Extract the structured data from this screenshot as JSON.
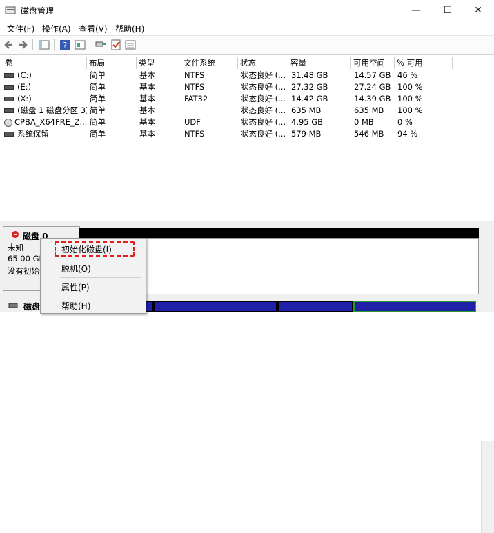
{
  "window": {
    "title": "磁盘管理",
    "minimize": "—",
    "maximize": "☐",
    "close": "✕"
  },
  "menu": [
    "文件(F)",
    "操作(A)",
    "查看(V)",
    "帮助(H)"
  ],
  "columns": [
    "卷",
    "布局",
    "类型",
    "文件系统",
    "状态",
    "容量",
    "可用空间",
    "% 可用"
  ],
  "volumes": [
    {
      "name": "(C:)",
      "layout": "简单",
      "type": "基本",
      "fs": "NTFS",
      "status": "状态良好 (...",
      "capacity": "31.48 GB",
      "free": "14.57 GB",
      "pct": "46 %",
      "icon": "drive-icon"
    },
    {
      "name": "(E:)",
      "layout": "简单",
      "type": "基本",
      "fs": "NTFS",
      "status": "状态良好 (...",
      "capacity": "27.32 GB",
      "free": "27.24 GB",
      "pct": "100 %",
      "icon": "drive-icon"
    },
    {
      "name": "(X:)",
      "layout": "简单",
      "type": "基本",
      "fs": "FAT32",
      "status": "状态良好 (...",
      "capacity": "14.42 GB",
      "free": "14.39 GB",
      "pct": "100 %",
      "icon": "drive-icon"
    },
    {
      "name": "(磁盘 1 磁盘分区 3)",
      "layout": "简单",
      "type": "基本",
      "fs": "",
      "status": "状态良好 (...",
      "capacity": "635 MB",
      "free": "635 MB",
      "pct": "100 %",
      "icon": "drive-icon"
    },
    {
      "name": "CPBA_X64FRE_Z...",
      "layout": "简单",
      "type": "基本",
      "fs": "UDF",
      "status": "状态良好 (...",
      "capacity": "4.95 GB",
      "free": "0 MB",
      "pct": "0 %",
      "icon": "cd-icon"
    },
    {
      "name": "系统保留",
      "layout": "简单",
      "type": "基本",
      "fs": "NTFS",
      "status": "状态良好 (...",
      "capacity": "579 MB",
      "free": "546 MB",
      "pct": "94 %",
      "icon": "drive-icon"
    }
  ],
  "disk0": {
    "name": "磁盘 0",
    "line1": "未知",
    "line2": "65.00 GB",
    "line3": "没有初始化"
  },
  "disk1": {
    "name": "磁盘"
  },
  "context_menu": {
    "items": [
      "初始化磁盘(I)",
      "脱机(O)",
      "属性(P)",
      "帮助(H)"
    ]
  }
}
